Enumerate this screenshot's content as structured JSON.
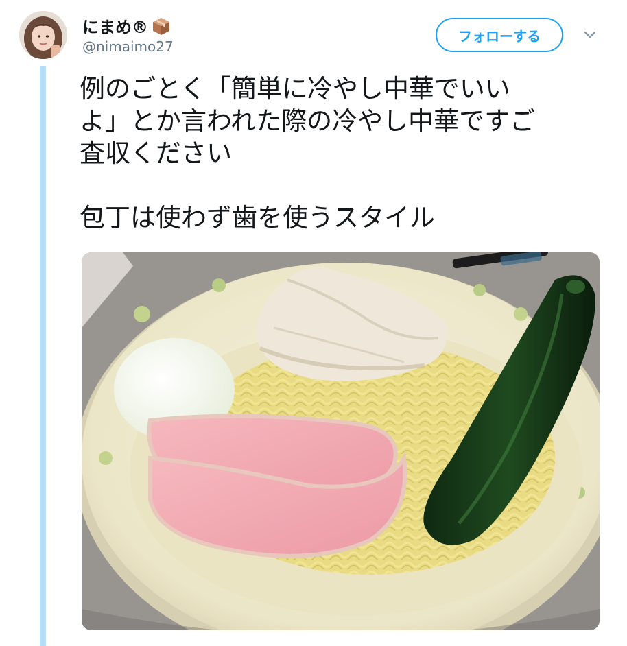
{
  "user": {
    "display_name": "にまめ®",
    "name_emoji_icon": "package-box-icon",
    "handle": "@nimaimo27"
  },
  "actions": {
    "follow_label": "フォローする",
    "menu_icon": "chevron-down-icon"
  },
  "tweet": {
    "lines": [
      "例のごとく「簡単に冷やし中華でいい",
      "よ」とか言われた際の冷やし中華ですご",
      "査収ください",
      "包丁は使わず歯を使うスタイル"
    ]
  },
  "colors": {
    "accent": "#1da1f2",
    "thread_line": "#b8def7",
    "handle_gray": "#657786",
    "text": "#14171a"
  }
}
